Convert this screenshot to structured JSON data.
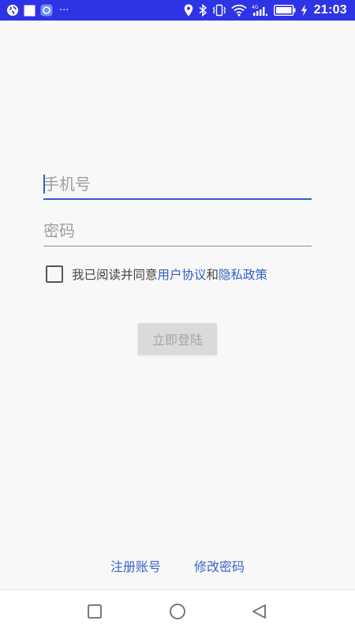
{
  "status_bar": {
    "time": "21:03",
    "network_label": "4G",
    "left_icons": [
      "globe-icon",
      "app-square-icon",
      "app-circle-icon",
      "more-dots-icon"
    ],
    "right_icons": [
      "location-icon",
      "bluetooth-icon",
      "vibrate-icon",
      "wifi-icon",
      "signal-icon",
      "battery-icon",
      "charging-icon"
    ],
    "more_dots": "···"
  },
  "login_form": {
    "phone": {
      "placeholder": "手机号",
      "value": ""
    },
    "password": {
      "placeholder": "密码",
      "value": ""
    },
    "agreement": {
      "prefix": "我已阅读并同意",
      "user_agreement": "用户协议",
      "conjunction": "和",
      "privacy_policy": "隐私政策",
      "checked": false
    },
    "submit_label": "立即登陆"
  },
  "footer": {
    "register_label": "注册账号",
    "change_password_label": "修改密码"
  },
  "nav_bar": {
    "icons": [
      "recent-apps-icon",
      "home-icon",
      "back-icon"
    ]
  },
  "colors": {
    "status_bar": "#2f33e6",
    "accent": "#2f5fc4",
    "background": "#f8f8f9",
    "button_disabled": "#dadada"
  }
}
